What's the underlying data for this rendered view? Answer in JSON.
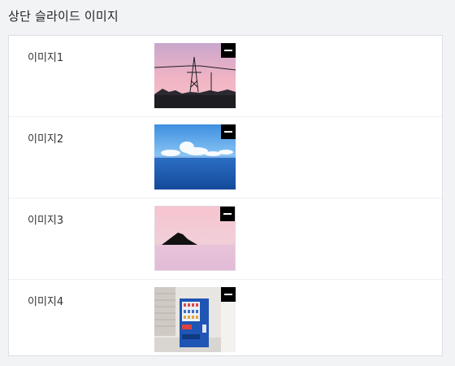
{
  "section": {
    "title": "상단 슬라이드 이미지"
  },
  "rows": [
    {
      "label": "이미지1",
      "image": "pink-sky-power-tower"
    },
    {
      "label": "이미지2",
      "image": "blue-ocean-clouds"
    },
    {
      "label": "이미지3",
      "image": "pink-sea-island"
    },
    {
      "label": "이미지4",
      "image": "blue-vending-machine"
    }
  ],
  "icons": {
    "remove": "minus-icon"
  }
}
